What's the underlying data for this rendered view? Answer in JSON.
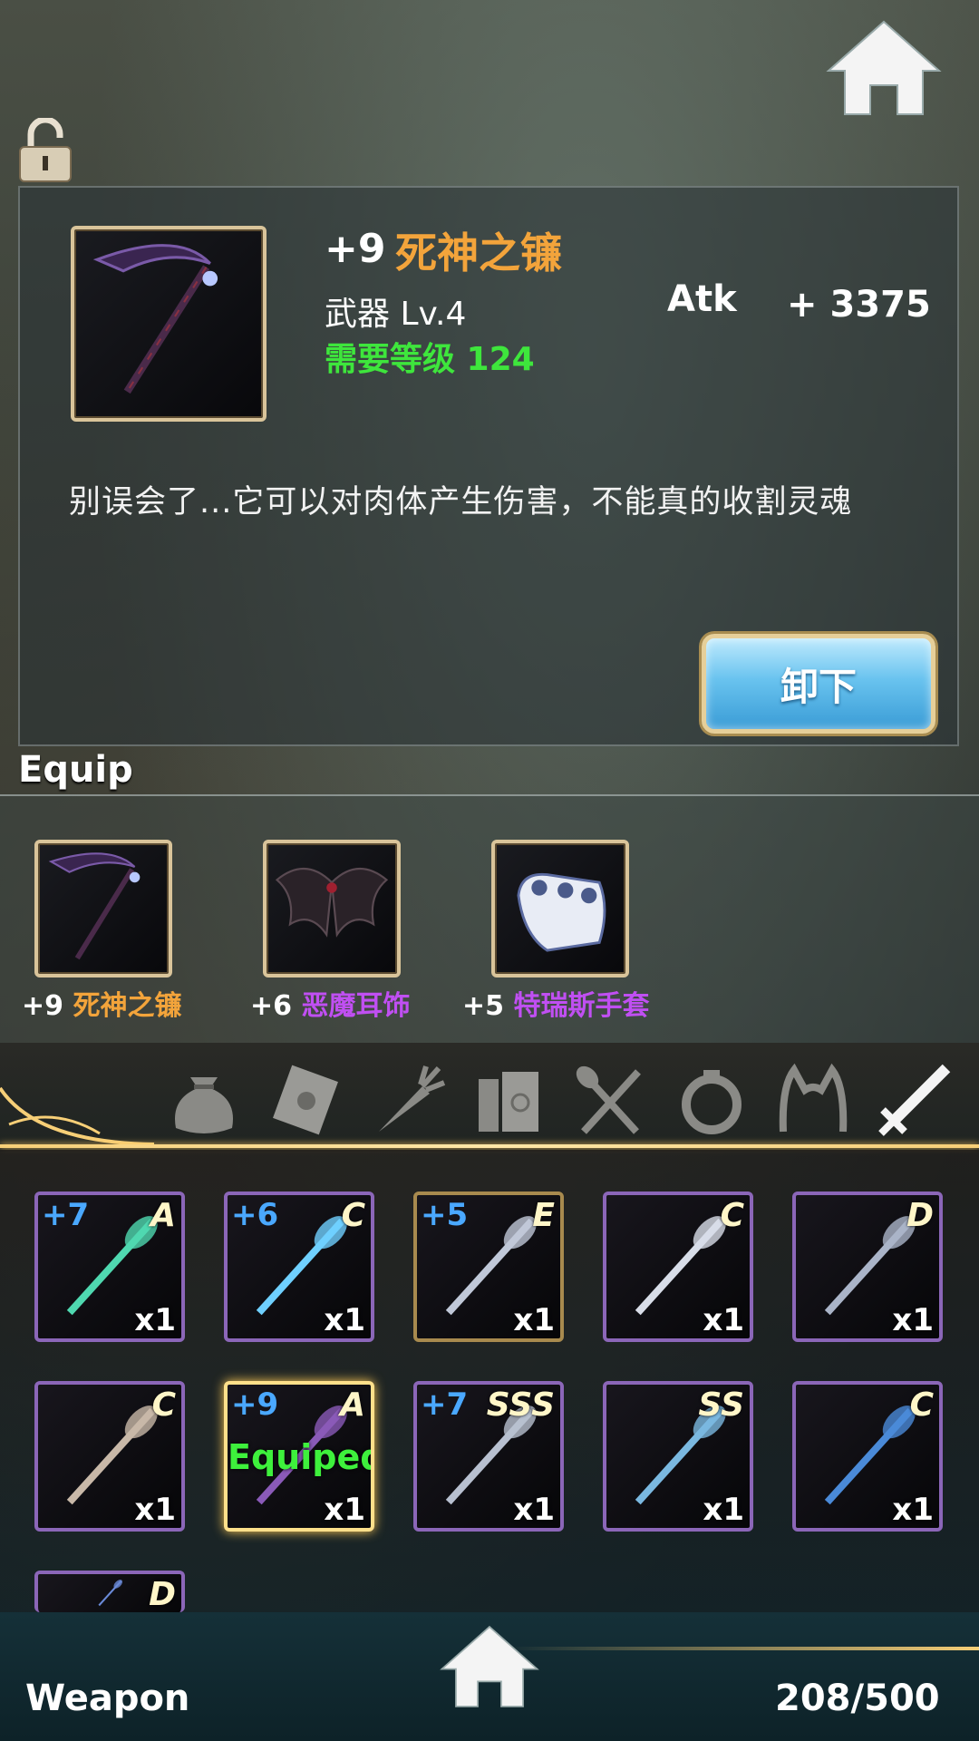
{
  "top": {
    "home_icon": "home-icon",
    "lock_icon": "unlocked-padlock-icon"
  },
  "detail": {
    "enhance": "+9",
    "name": "死神之镰",
    "type_level": "武器 Lv.4",
    "required_level": "需要等级 124",
    "stat_label": "Atk",
    "stat_value": "+ 3375",
    "description": "别误会了...它可以对肉体产生伤害，不能真的收割灵魂",
    "unequip_label": "卸下",
    "icon": "scythe-icon"
  },
  "equip": {
    "title": "Equip",
    "slots": [
      {
        "enhance": "+9",
        "name": "死神之镰",
        "color": "#f3a43b",
        "icon": "scythe-icon"
      },
      {
        "enhance": "+6",
        "name": "恶魔耳饰",
        "color": "#c04ff2",
        "icon": "demon-wing-earring-icon"
      },
      {
        "enhance": "+5",
        "name": "特瑞斯手套",
        "color": "#c04ff2",
        "icon": "gauntlet-icon"
      }
    ]
  },
  "tabs": [
    {
      "icon": "money-bag-icon",
      "active": false
    },
    {
      "icon": "scroll-icon",
      "active": false
    },
    {
      "icon": "carrot-icon",
      "active": false
    },
    {
      "icon": "books-icon",
      "active": false
    },
    {
      "icon": "spoon-fork-icon",
      "active": false
    },
    {
      "icon": "ring-icon",
      "active": false
    },
    {
      "icon": "cat-ears-headband-icon",
      "active": false
    },
    {
      "icon": "sword-icon",
      "active": true
    }
  ],
  "inventory": [
    {
      "enhance": "+7",
      "grade": "A",
      "qty": "x1",
      "icon": "jade-staff-icon",
      "hue": "#4fd8b0",
      "frame": "purple"
    },
    {
      "enhance": "+6",
      "grade": "C",
      "qty": "x1",
      "icon": "lightning-staff-icon",
      "hue": "#6fd0ff",
      "frame": "purple"
    },
    {
      "enhance": "+5",
      "grade": "E",
      "qty": "x1",
      "icon": "dark-spear-icon",
      "hue": "#c0c8d8",
      "frame": "gold"
    },
    {
      "enhance": "",
      "grade": "C",
      "qty": "x1",
      "icon": "curved-blade-icon",
      "hue": "#d8dde8",
      "frame": "purple"
    },
    {
      "enhance": "",
      "grade": "D",
      "qty": "x1",
      "icon": "jagged-dagger-icon",
      "hue": "#aab4c8",
      "frame": "purple"
    },
    {
      "enhance": "",
      "grade": "C",
      "qty": "x1",
      "icon": "halberd-icon",
      "hue": "#c8b8a8",
      "frame": "purple"
    },
    {
      "enhance": "+9",
      "grade": "A",
      "qty": "x1",
      "icon": "scythe-icon",
      "hue": "#8a5ab8",
      "frame": "equipped",
      "status": "Equiped"
    },
    {
      "enhance": "+7",
      "grade": "SSS",
      "qty": "x1",
      "icon": "crossbow-icon",
      "hue": "#b8c0d0",
      "frame": "purple"
    },
    {
      "enhance": "",
      "grade": "SS",
      "qty": "x1",
      "icon": "bow-icon",
      "hue": "#7ab8e0",
      "frame": "purple"
    },
    {
      "enhance": "",
      "grade": "C",
      "qty": "x1",
      "icon": "ornate-staff-icon",
      "hue": "#4a8ad8",
      "frame": "purple"
    },
    {
      "enhance": "",
      "grade": "D",
      "qty": "",
      "icon": "partial-item-icon",
      "hue": "#6a8ad8",
      "frame": "purple"
    }
  ],
  "footer": {
    "category": "Weapon",
    "count": "208/500",
    "home_icon": "home-icon"
  }
}
